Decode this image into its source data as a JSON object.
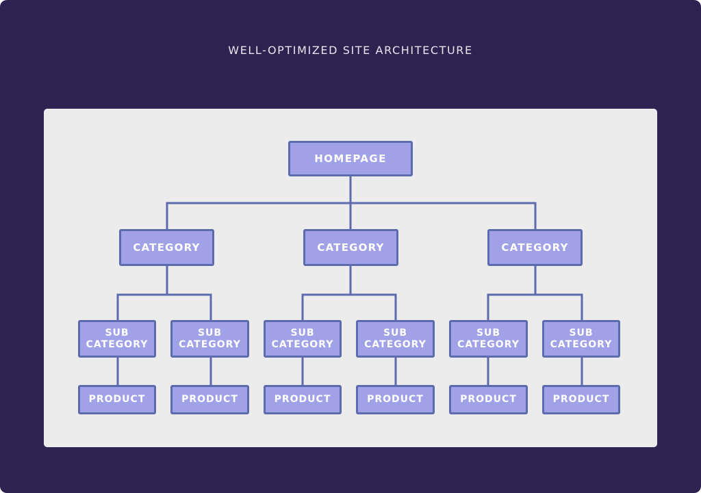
{
  "title": "WELL-OPTIMIZED SITE ARCHITECTURE",
  "colors": {
    "background": "#2e2350",
    "panel": "#ececec",
    "node_fill": "#a1a1e8",
    "node_border": "#5c6aae",
    "connector": "#5c6aae",
    "node_text": "#ffffff",
    "title_text": "#e8e6f2"
  },
  "tree": {
    "homepage": {
      "label": "HOMEPAGE"
    },
    "categories": [
      {
        "label": "CATEGORY",
        "subcategories": [
          {
            "label": "SUB\nCATEGORY",
            "product": "PRODUCT"
          },
          {
            "label": "SUB\nCATEGORY",
            "product": "PRODUCT"
          }
        ]
      },
      {
        "label": "CATEGORY",
        "subcategories": [
          {
            "label": "SUB\nCATEGORY",
            "product": "PRODUCT"
          },
          {
            "label": "SUB\nCATEGORY",
            "product": "PRODUCT"
          }
        ]
      },
      {
        "label": "CATEGORY",
        "subcategories": [
          {
            "label": "SUB\nCATEGORY",
            "product": "PRODUCT"
          },
          {
            "label": "SUB\nCATEGORY",
            "product": "PRODUCT"
          }
        ]
      }
    ]
  }
}
